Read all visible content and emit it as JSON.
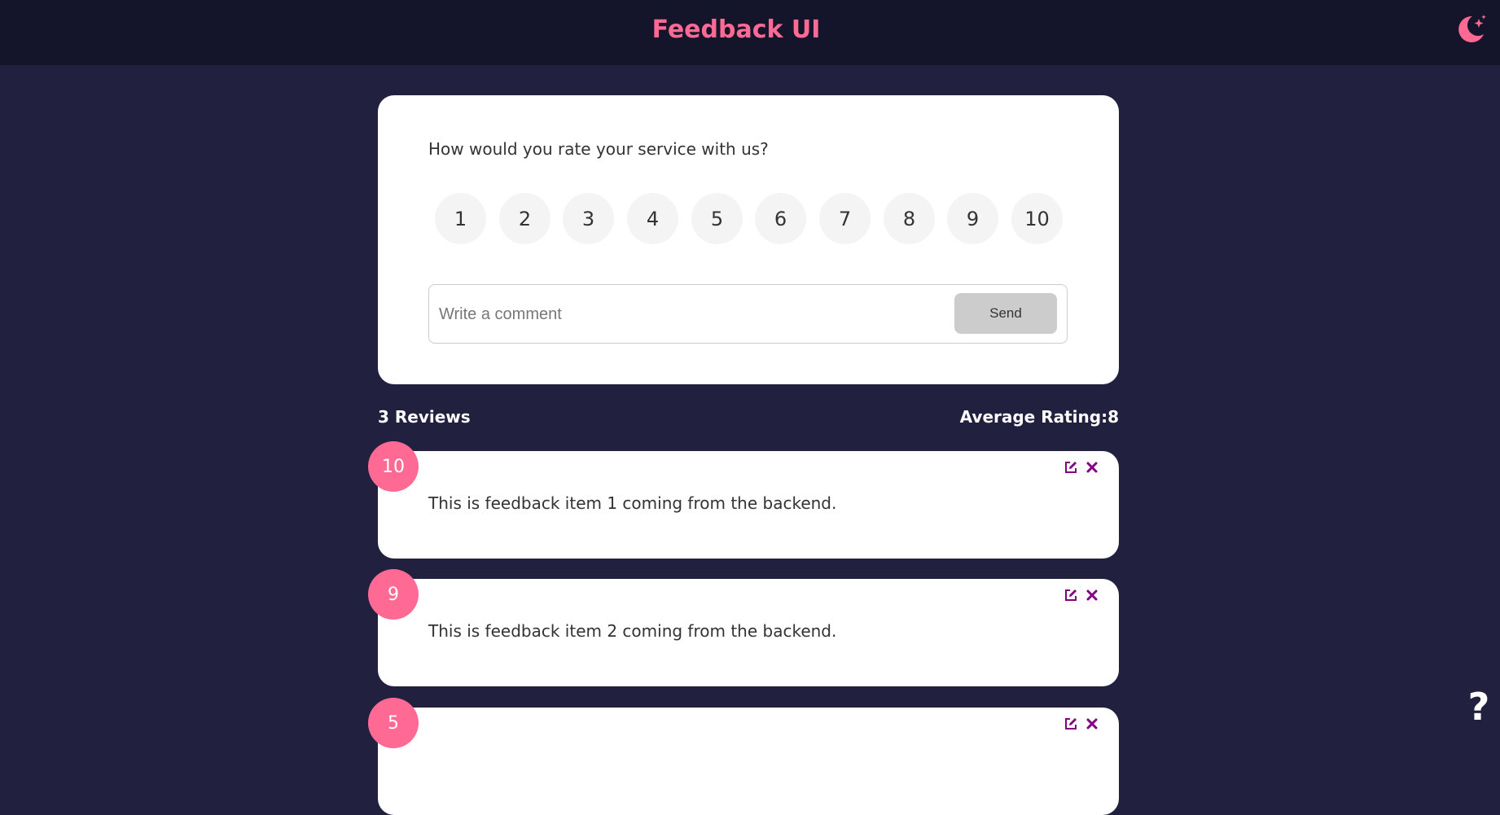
{
  "header": {
    "title": "Feedback UI",
    "theme_icon": "moon-stars-icon",
    "accent_color": "#ff6a95"
  },
  "form": {
    "question": "How would you rate your service with us?",
    "ratings": [
      "1",
      "2",
      "3",
      "4",
      "5",
      "6",
      "7",
      "8",
      "9",
      "10"
    ],
    "comment_placeholder": "Write a comment",
    "comment_value": "",
    "send_label": "Send"
  },
  "stats": {
    "reviews_label": "3 Reviews",
    "average_label": "Average Rating:8"
  },
  "feedback": [
    {
      "rating": "10",
      "text": "This is feedback item 1 coming from the backend."
    },
    {
      "rating": "9",
      "text": "This is feedback item 2 coming from the backend."
    },
    {
      "rating": "5",
      "text": ""
    }
  ],
  "icons": {
    "edit": "edit-icon",
    "delete": "close-icon",
    "help": "question-mark-icon"
  },
  "help": {
    "label": "?"
  }
}
